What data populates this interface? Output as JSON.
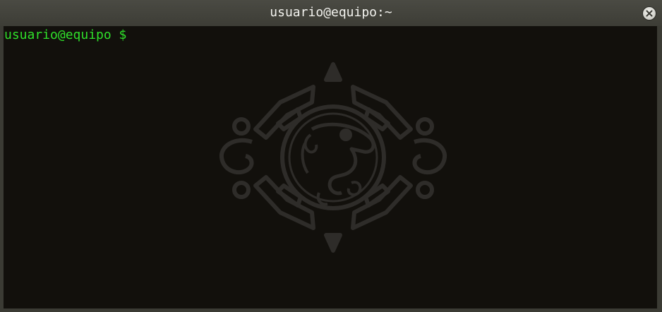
{
  "window": {
    "title": "usuario@equipo:~",
    "close_icon": "close-icon"
  },
  "terminal": {
    "prompt": "usuario@equipo $ ",
    "background_color": "#12100c",
    "prompt_color": "#2fe02a",
    "watermark_icon": "aztec-sun-stone-icon"
  }
}
